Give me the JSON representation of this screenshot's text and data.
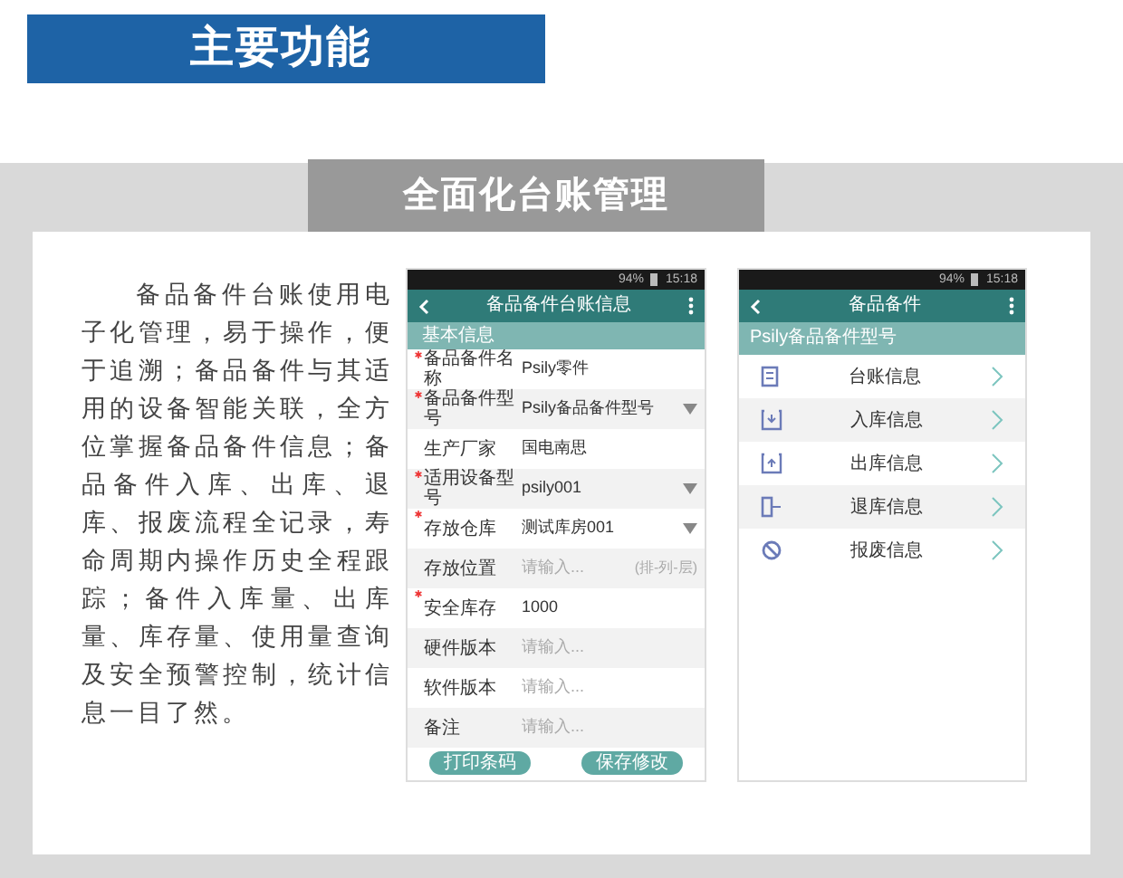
{
  "header": {
    "title": "主要功能"
  },
  "section": {
    "title": "全面化台账管理",
    "description": "备品备件台账使用电子化管理，易于操作，便于追溯；备品备件与其适用的设备智能关联，全方位掌握备品备件信息；备品备件入库、出库、退库、报废流程全记录，寿命周期内操作历史全程跟踪；备件入库量、出库量、库存量、使用量查询及安全预警控制，统计信息一目了然。"
  },
  "phone_left": {
    "status": {
      "battery": "94%",
      "time": "15:18"
    },
    "title": "备品备件台账信息",
    "group": "基本信息",
    "fields": [
      {
        "label": "备品备件名称",
        "required": true,
        "value": "Psily零件",
        "dropdown": false
      },
      {
        "label": "备品备件型号",
        "required": true,
        "value": "Psily备品备件型号",
        "dropdown": true
      },
      {
        "label": "生产厂家",
        "required": false,
        "value": "国电南思",
        "dropdown": false
      },
      {
        "label": "适用设备型号",
        "required": true,
        "value": "psily001",
        "dropdown": true
      },
      {
        "label": "存放仓库",
        "required": true,
        "value": "测试库房001",
        "dropdown": true
      },
      {
        "label": "存放位置",
        "required": false,
        "placeholder": "请输入...",
        "suffix": "(排-列-层)",
        "dropdown": false
      },
      {
        "label": "安全库存",
        "required": true,
        "value": "1000",
        "dropdown": false
      },
      {
        "label": "硬件版本",
        "required": false,
        "placeholder": "请输入...",
        "dropdown": false
      },
      {
        "label": "软件版本",
        "required": false,
        "placeholder": "请输入...",
        "dropdown": false
      },
      {
        "label": "备注",
        "required": false,
        "placeholder": "请输入...",
        "dropdown": false
      }
    ],
    "buttons": [
      "打印条码",
      "保存修改"
    ]
  },
  "phone_right": {
    "status": {
      "battery": "94%",
      "time": "15:18"
    },
    "title": "备品备件",
    "group": "Psily备品备件型号",
    "items": [
      {
        "label": "台账信息",
        "kind": "ledger"
      },
      {
        "label": "入库信息",
        "kind": "inbound"
      },
      {
        "label": "出库信息",
        "kind": "outbound"
      },
      {
        "label": "退库信息",
        "kind": "return"
      },
      {
        "label": "报废信息",
        "kind": "scrap"
      }
    ]
  }
}
